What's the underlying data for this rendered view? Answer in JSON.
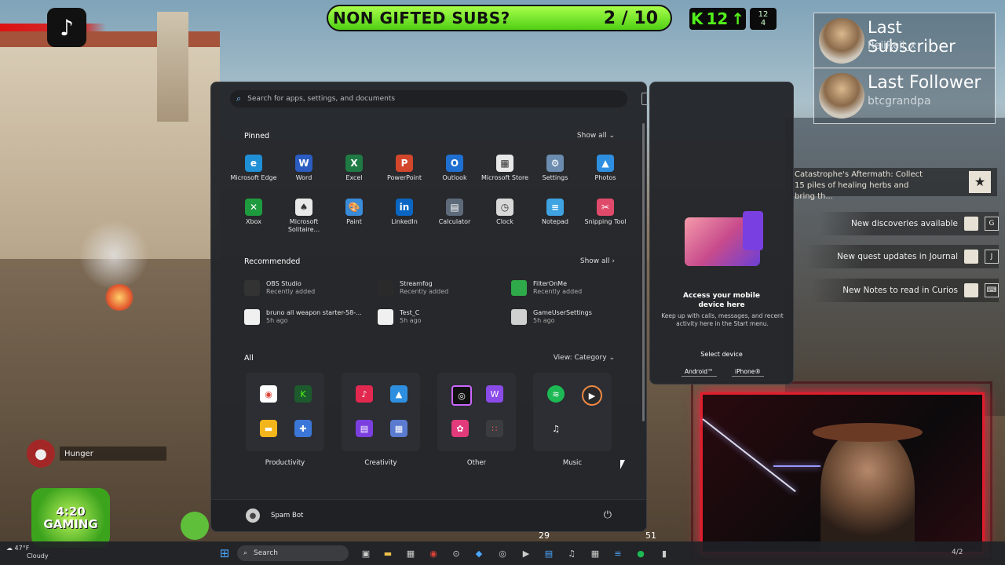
{
  "stream": {
    "subs_goal_label": "NON GIFTED SUBS?",
    "subs_goal_count": "2 / 10",
    "kick_count": "12",
    "kick_small_top": "12",
    "kick_small_bottom": "4",
    "last_subscriber_title": "Last Subscriber",
    "last_subscriber_name": "ReiiReii_x",
    "last_follower_title": "Last Follower",
    "last_follower_name": "btcgrandpa"
  },
  "game": {
    "quest_text": "Catastrophe's Aftermath: Collect 15 piles of healing herbs and bring th...",
    "notices": [
      {
        "text": "New discoveries available",
        "key": "G"
      },
      {
        "text": "New quest updates in Journal",
        "key": "J"
      },
      {
        "text": "New Notes to read in Curios",
        "key": "⌨"
      }
    ],
    "hunger_label": "Hunger",
    "logo_line1": "4:20",
    "logo_line2": "GAMING",
    "hud_number_left": "29",
    "hud_number_right": "51"
  },
  "start_menu": {
    "search_placeholder": "Search for apps, settings, and documents",
    "pinned_title": "Pinned",
    "show_all": "Show all",
    "pinned": [
      {
        "label": "Microsoft Edge",
        "icon": "edge-icon",
        "color": "#1f8fd6",
        "glyph": "e"
      },
      {
        "label": "Word",
        "icon": "word-icon",
        "color": "#2b5cc2",
        "glyph": "W"
      },
      {
        "label": "Excel",
        "icon": "excel-icon",
        "color": "#1f7a44",
        "glyph": "X"
      },
      {
        "label": "PowerPoint",
        "icon": "powerpoint-icon",
        "color": "#d2472b",
        "glyph": "P"
      },
      {
        "label": "Outlook",
        "icon": "outlook-icon",
        "color": "#1f6fd0",
        "glyph": "O"
      },
      {
        "label": "Microsoft Store",
        "icon": "store-icon",
        "color": "#e8e8e8",
        "glyph": "▦"
      },
      {
        "label": "Settings",
        "icon": "settings-icon",
        "color": "#6b8caf",
        "glyph": "⚙"
      },
      {
        "label": "Photos",
        "icon": "photos-icon",
        "color": "#2e8fe0",
        "glyph": "▲"
      },
      {
        "label": "Xbox",
        "icon": "xbox-icon",
        "color": "#1e9b3e",
        "glyph": "✕"
      },
      {
        "label": "Microsoft Solitaire...",
        "icon": "solitaire-icon",
        "color": "#e8e8e8",
        "glyph": "♠"
      },
      {
        "label": "Paint",
        "icon": "paint-icon",
        "color": "#3a8bd8",
        "glyph": "🎨"
      },
      {
        "label": "LinkedIn",
        "icon": "linkedin-icon",
        "color": "#0a66c2",
        "glyph": "in"
      },
      {
        "label": "Calculator",
        "icon": "calculator-icon",
        "color": "#5d6a7a",
        "glyph": "▤"
      },
      {
        "label": "Clock",
        "icon": "clock-icon",
        "color": "#d8d8d8",
        "glyph": "◷"
      },
      {
        "label": "Notepad",
        "icon": "notepad-icon",
        "color": "#3ea3e0",
        "glyph": "≡"
      },
      {
        "label": "Snipping Tool",
        "icon": "snipping-icon",
        "color": "#e04a6a",
        "glyph": "✂"
      }
    ],
    "recommended_title": "Recommended",
    "recommended": [
      {
        "name": "OBS Studio",
        "sub": "Recently added",
        "icon": "obs-icon",
        "color": "#333"
      },
      {
        "name": "Streamfog",
        "sub": "Recently added",
        "icon": "streamfog-icon",
        "color": "#2a2a2a"
      },
      {
        "name": "FilterOnMe",
        "sub": "Recently added",
        "icon": "filteronme-icon",
        "color": "#2faa4a"
      },
      {
        "name": "bruno all weapon starter-58-...",
        "sub": "5h ago",
        "icon": "file-icon",
        "color": "#f0f0f0"
      },
      {
        "name": "Test_C",
        "sub": "5h ago",
        "icon": "file-icon",
        "color": "#f0f0f0"
      },
      {
        "name": "GameUserSettings",
        "sub": "5h ago",
        "icon": "config-file-icon",
        "color": "#d0d0d0"
      }
    ],
    "all_title": "All",
    "view_label": "View: Category",
    "categories": [
      {
        "label": "Productivity"
      },
      {
        "label": "Creativity"
      },
      {
        "label": "Other"
      },
      {
        "label": "Music"
      }
    ],
    "user_name": "Spam Bot"
  },
  "phone_link": {
    "heading": "Access your mobile device here",
    "body": "Keep up with calls, messages, and recent activity here in the Start menu.",
    "select": "Select device",
    "android": "Android™",
    "iphone": "iPhone®"
  },
  "taskbar": {
    "search_label": "Search",
    "weather_temp": "47°F",
    "weather_desc": "Cloudy",
    "clock": "4/2"
  }
}
